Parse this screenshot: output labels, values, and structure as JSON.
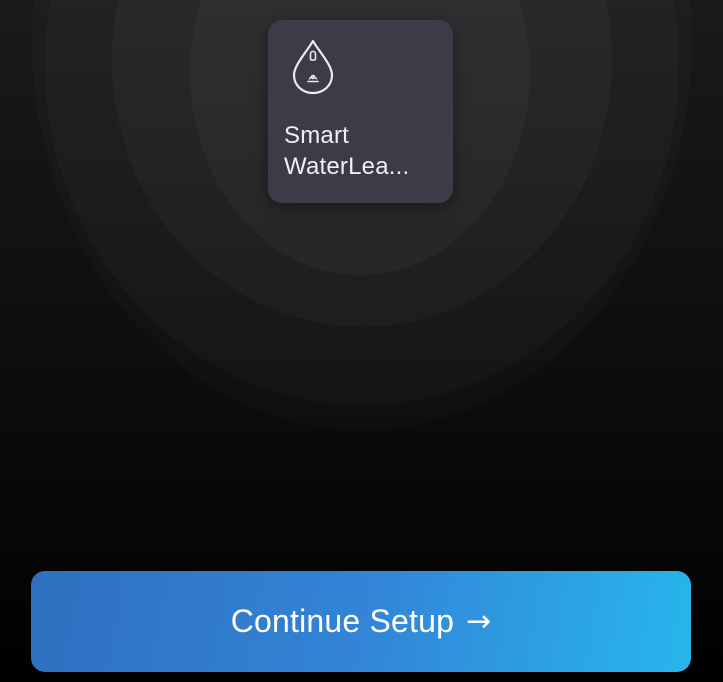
{
  "device": {
    "name_line1": "Smart",
    "name_line2": "WaterLea...",
    "icon": "water-drop-icon"
  },
  "actions": {
    "continue_label": "Continue Setup",
    "continue_arrow": "→"
  },
  "colors": {
    "background": "#000000",
    "card": "#3b3c48",
    "button_start": "#2f6fbf",
    "button_end": "#27b6ec",
    "text": "#ffffff"
  }
}
